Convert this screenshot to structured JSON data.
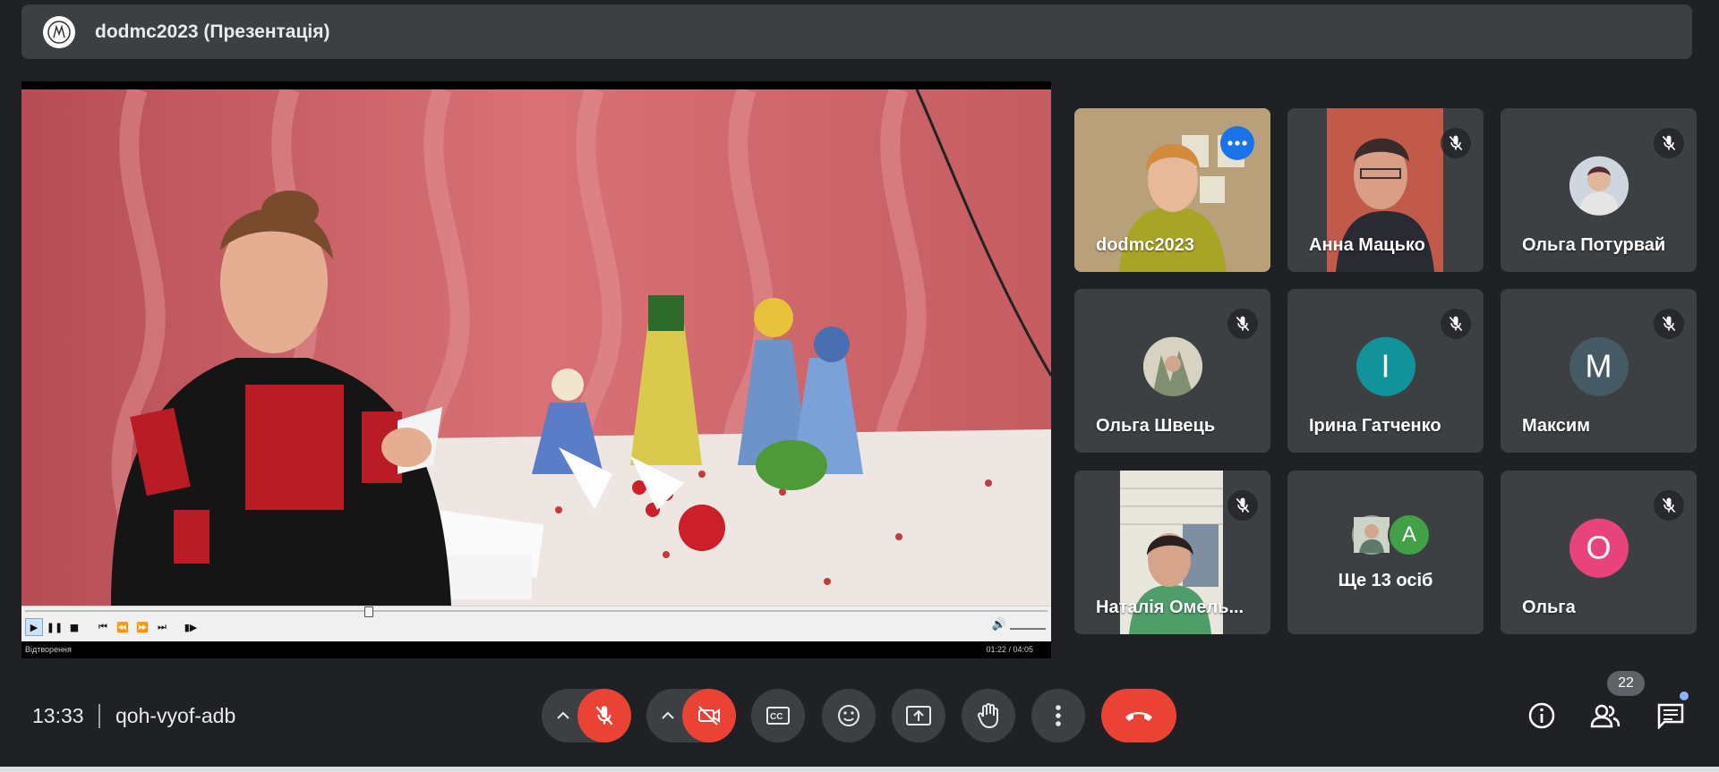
{
  "window": {
    "title": "dodmc2023 (Презентація)"
  },
  "player": {
    "status_label": "Відтворення",
    "time": "01:22 / 04:05",
    "progress": 0.335
  },
  "participants": [
    {
      "name": "dodmc2023",
      "kind": "video",
      "active": true
    },
    {
      "name": "Анна Мацько",
      "kind": "video",
      "muted": true
    },
    {
      "name": "Ольга Потурвай",
      "kind": "photo-avatar",
      "muted": true
    },
    {
      "name": "Ольга Швець",
      "kind": "photo-avatar",
      "muted": true
    },
    {
      "name": "Ірина Гатченко",
      "kind": "initial",
      "initial": "І",
      "color": "#12939a",
      "muted": true
    },
    {
      "name": "Максим",
      "kind": "initial",
      "initial": "М",
      "color": "#455a64",
      "muted": true
    },
    {
      "name": "Наталія Омель...",
      "kind": "video",
      "muted": true
    },
    {
      "name": "Ще 13 осіб",
      "kind": "group",
      "initial": "А",
      "color": "#43a047"
    },
    {
      "name": "Ольга",
      "kind": "initial",
      "initial": "О",
      "color": "#e8437a",
      "muted": true
    }
  ],
  "meeting": {
    "clock": "13:33",
    "code": "qoh-vyof-adb",
    "participant_count": "22"
  },
  "icons": {
    "mic": "mic-off-icon",
    "camera": "videocam-off-icon",
    "captions": "closed-caption-icon",
    "reactions": "emoji-icon",
    "present": "present-to-all-icon",
    "hand": "raise-hand-icon",
    "more": "more-vert-icon",
    "hangup": "call-end-icon",
    "info": "info-icon",
    "people": "people-icon",
    "chat": "chat-icon"
  },
  "colors": {
    "accent": "#8ab4f8",
    "danger": "#ea4335",
    "surface": "#3c4043",
    "background": "#202124"
  }
}
